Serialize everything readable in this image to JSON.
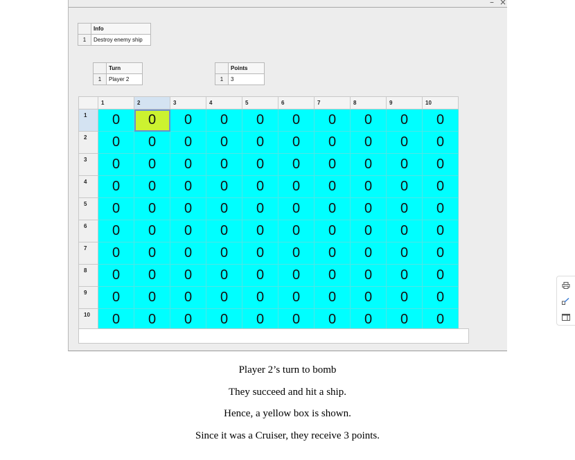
{
  "window": {
    "minimize_label": "–",
    "close_label": "×"
  },
  "info_table": {
    "header": "Info",
    "row_number": "1",
    "value": "Destroy enemy ship"
  },
  "turn_table": {
    "header": "Turn",
    "row_number": "1",
    "value": "Player 2"
  },
  "points_table": {
    "header": "Points",
    "row_number": "1",
    "value": "3"
  },
  "grid": {
    "column_headers": [
      "1",
      "2",
      "3",
      "4",
      "5",
      "6",
      "7",
      "8",
      "9",
      "10"
    ],
    "row_headers": [
      "1",
      "2",
      "3",
      "4",
      "5",
      "6",
      "7",
      "8",
      "9",
      "10"
    ],
    "cells": [
      [
        "0",
        "0",
        "0",
        "0",
        "0",
        "0",
        "0",
        "0",
        "0",
        "0"
      ],
      [
        "0",
        "0",
        "0",
        "0",
        "0",
        "0",
        "0",
        "0",
        "0",
        "0"
      ],
      [
        "0",
        "0",
        "0",
        "0",
        "0",
        "0",
        "0",
        "0",
        "0",
        "0"
      ],
      [
        "0",
        "0",
        "0",
        "0",
        "0",
        "0",
        "0",
        "0",
        "0",
        "0"
      ],
      [
        "0",
        "0",
        "0",
        "0",
        "0",
        "0",
        "0",
        "0",
        "0",
        "0"
      ],
      [
        "0",
        "0",
        "0",
        "0",
        "0",
        "0",
        "0",
        "0",
        "0",
        "0"
      ],
      [
        "0",
        "0",
        "0",
        "0",
        "0",
        "0",
        "0",
        "0",
        "0",
        "0"
      ],
      [
        "0",
        "0",
        "0",
        "0",
        "0",
        "0",
        "0",
        "0",
        "0",
        "0"
      ],
      [
        "0",
        "0",
        "0",
        "0",
        "0",
        "0",
        "0",
        "0",
        "0",
        "0"
      ],
      [
        "0",
        "0",
        "0",
        "0",
        "0",
        "0",
        "0",
        "0",
        "0",
        "0"
      ]
    ],
    "hit_cell": {
      "row": 1,
      "column": 2
    },
    "colors": {
      "water": "#00ffff",
      "hit": "#ccf230",
      "selected_header": "#d4e3f2"
    }
  },
  "side_panel": {
    "icons": [
      "print-icon",
      "edit-icon",
      "layout-icon"
    ]
  },
  "captions": [
    "Player 2’s turn to bomb",
    "They succeed and hit a ship.",
    "Hence, a yellow box is shown.",
    "Since it was a Cruiser, they receive 3 points."
  ]
}
